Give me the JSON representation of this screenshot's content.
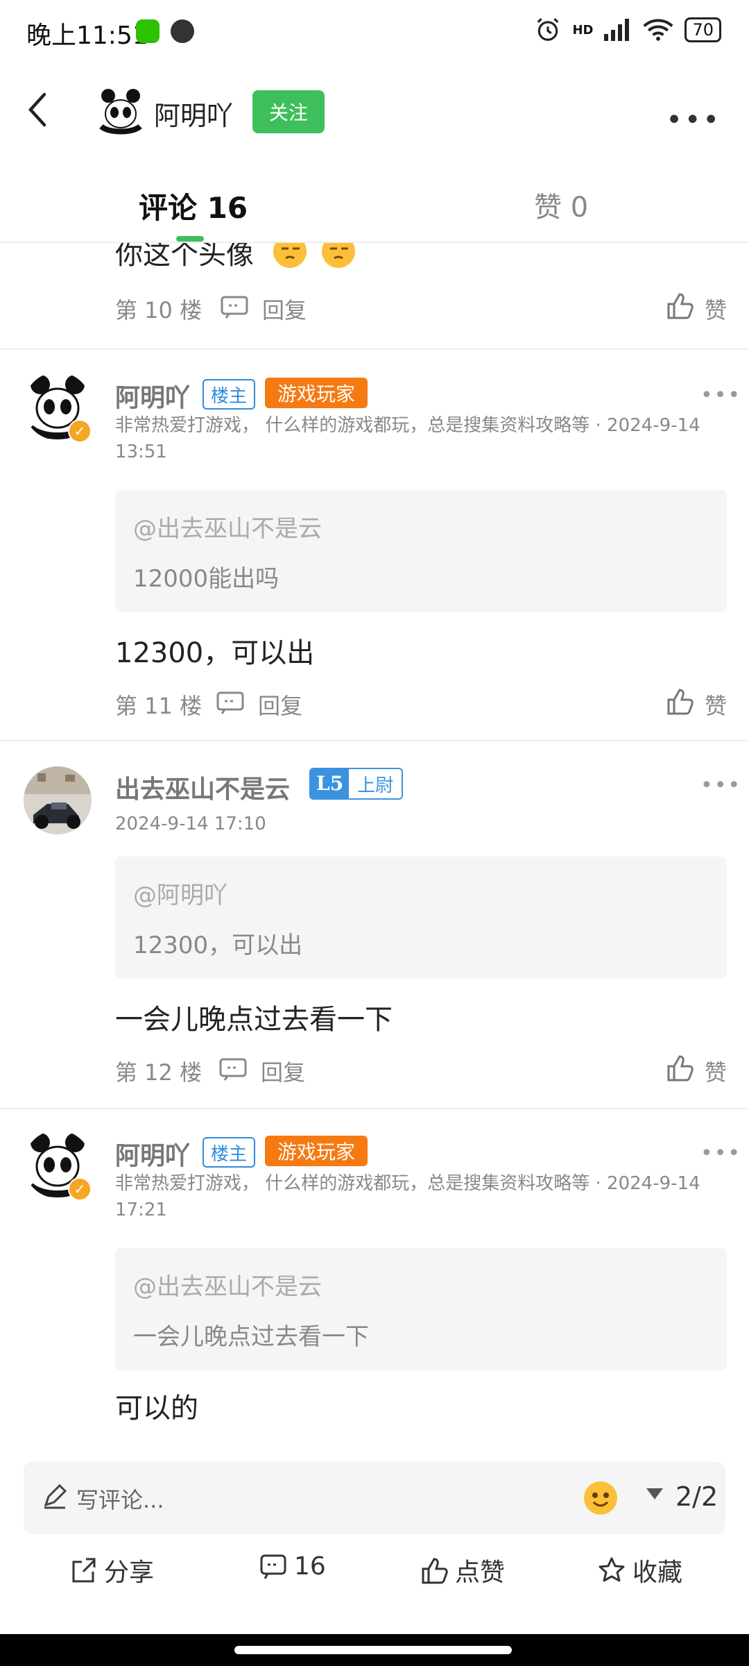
{
  "status_bar": {
    "time": "晚上11:51",
    "network": "HD",
    "battery": "70"
  },
  "header": {
    "author_name": "阿明吖",
    "follow_label": "关注"
  },
  "tabs": {
    "comments": "评论 16",
    "likes": "赞 0"
  },
  "top_partial": {
    "text": "你这个头像",
    "floor": "第 10 楼",
    "reply": "回复",
    "like": "赞"
  },
  "comments": [
    {
      "name": "阿明吖",
      "owner_badge": "楼主",
      "title_badge": "游戏玩家",
      "meta_line1": "非常热爱打游戏， 什么样的游戏都玩，总是搜集资料攻略等 · 2024-9-14",
      "meta_line2": "13:51",
      "quote_at": "@出去巫山不是云",
      "quote_text": "12000能出吗",
      "text": "12300，可以出",
      "floor": "第 11 楼",
      "reply": "回复",
      "like": "赞"
    },
    {
      "name": "出去巫山不是云",
      "level": "L5",
      "rank": "上尉",
      "meta_line1": "2024-9-14 17:10",
      "quote_at": "@阿明吖",
      "quote_text": "12300，可以出",
      "text": "一会儿晚点过去看一下",
      "floor": "第 12 楼",
      "reply": "回复",
      "like": "赞"
    },
    {
      "name": "阿明吖",
      "owner_badge": "楼主",
      "title_badge": "游戏玩家",
      "meta_line1": "非常热爱打游戏， 什么样的游戏都玩，总是搜集资料攻略等 · 2024-9-14",
      "meta_line2": "17:21",
      "quote_at": "@出去巫山不是云",
      "quote_text": "一会儿晚点过去看一下",
      "text": "可以的"
    }
  ],
  "compose": {
    "placeholder": "写评论...",
    "page": "2/2"
  },
  "actions": {
    "share": "分享",
    "comments": "16",
    "like": "点赞",
    "favorite": "收藏"
  },
  "colors": {
    "accent_green": "#3fbf5b",
    "owner_blue": "#2f8cde",
    "gamer_orange": "#f57a12"
  }
}
